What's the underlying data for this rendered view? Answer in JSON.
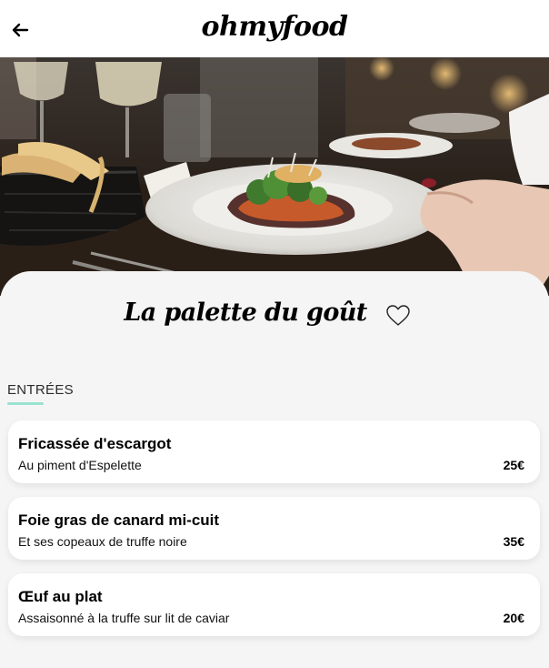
{
  "header": {
    "back_icon": "arrow-left-icon",
    "logo": "ohmyfood"
  },
  "hero": {
    "image": "restaurant-dish-photo"
  },
  "restaurant": {
    "name": "La palette du goût",
    "favorite_icon": "heart-outline-icon"
  },
  "section": {
    "title": "ENTRÉES",
    "accent_color": "#99e2d0"
  },
  "dishes": [
    {
      "name": "Fricassée d'escargot",
      "description": "Au piment d'Espelette",
      "price": "25€"
    },
    {
      "name": "Foie gras de canard mi-cuit",
      "description": "Et ses copeaux de truffe noire",
      "price": "35€"
    },
    {
      "name": "Œuf au plat",
      "description": "Assaisonné à la truffe sur lit de caviar",
      "price": "20€"
    }
  ]
}
